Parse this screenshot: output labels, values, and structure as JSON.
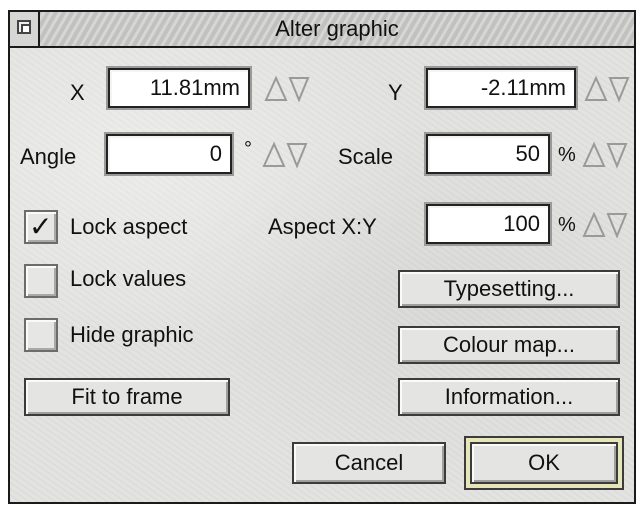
{
  "window": {
    "title": "Alter graphic"
  },
  "fields": {
    "x": {
      "label": "X",
      "value": "11.81mm"
    },
    "y": {
      "label": "Y",
      "value": "-2.11mm"
    },
    "angle": {
      "label": "Angle",
      "value": "0",
      "unit": "°"
    },
    "scale": {
      "label": "Scale",
      "value": "50",
      "unit": "%"
    },
    "aspect": {
      "label": "Aspect X:Y",
      "value": "100",
      "unit": "%"
    }
  },
  "checkboxes": {
    "lock_aspect": {
      "label": "Lock aspect",
      "checked": true,
      "mark": "✓"
    },
    "lock_values": {
      "label": "Lock values",
      "checked": false
    },
    "hide_graphic": {
      "label": "Hide graphic",
      "checked": false
    }
  },
  "buttons": {
    "fit_to_frame": "Fit to frame",
    "typesetting": "Typesetting...",
    "colour_map": "Colour map...",
    "information": "Information...",
    "cancel": "Cancel",
    "ok": "OK"
  }
}
